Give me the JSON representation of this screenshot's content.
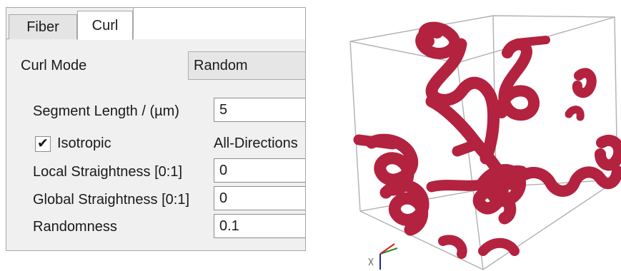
{
  "tabs": {
    "fiber": "Fiber",
    "curl": "Curl"
  },
  "curl_mode": {
    "label": "Curl Mode",
    "value": "Random"
  },
  "segment_length": {
    "label": "Segment Length / (µm)",
    "value": "5"
  },
  "isotropic": {
    "label": "Isotropic",
    "checked": true,
    "check_glyph": "✔",
    "direction": "All-Directions"
  },
  "local_straightness": {
    "label": "Local Straightness [0:1]",
    "value": "0"
  },
  "global_straightness": {
    "label": "Global Straightness [0:1]",
    "value": "0"
  },
  "randomness": {
    "label": "Randomness",
    "value": "0.1"
  },
  "viewport": {
    "fiber_color": "#b3223f",
    "highlight_color": "#d9506a",
    "box_color": "#b0b0b0"
  }
}
